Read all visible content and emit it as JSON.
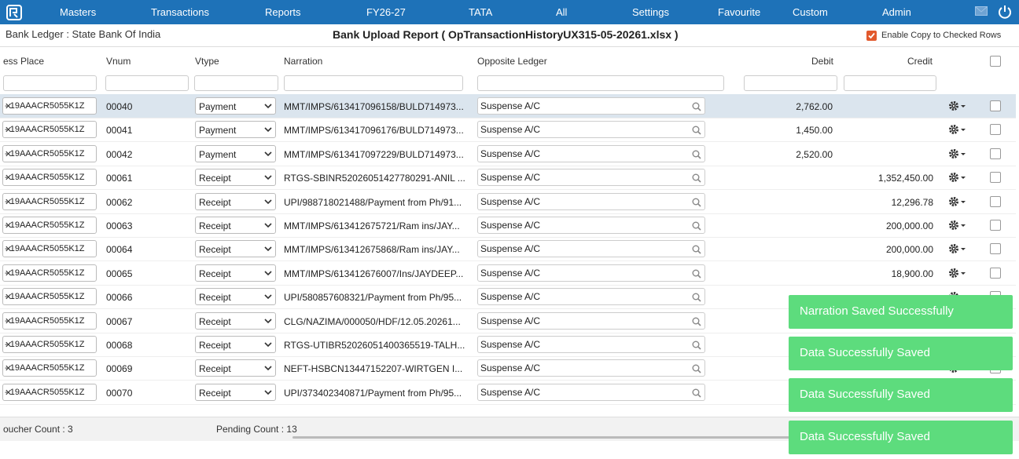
{
  "nav": {
    "items": [
      "Masters",
      "Transactions",
      "Reports",
      "FY26-27",
      "TATA",
      "All",
      "Settings",
      "Favourite",
      "Custom",
      "Admin"
    ]
  },
  "subheader": {
    "ledger_title": "Bank Ledger : State Bank Of India",
    "report_title": "Bank Upload Report ( OpTransactionHistoryUX315-05-20261.xlsx )",
    "copy_label": "Enable Copy to Checked Rows",
    "copy_checked": true
  },
  "columns": [
    "ess Place",
    "Vnum",
    "Vtype",
    "Narration",
    "Opposite Ledger",
    "Debit",
    "Credit"
  ],
  "rows": [
    {
      "place": "- 19AAACR5055K1Z",
      "vnum": "00040",
      "vtype": "Payment",
      "narration": "MMT/IMPS/613417096158/BULD714973...",
      "opposite": "Suspense A/C",
      "debit": "2,762.00",
      "credit": ""
    },
    {
      "place": "- 19AAACR5055K1Z",
      "vnum": "00041",
      "vtype": "Payment",
      "narration": "MMT/IMPS/613417096176/BULD714973...",
      "opposite": "Suspense A/C",
      "debit": "1,450.00",
      "credit": ""
    },
    {
      "place": "- 19AAACR5055K1Z",
      "vnum": "00042",
      "vtype": "Payment",
      "narration": "MMT/IMPS/613417097229/BULD714973...",
      "opposite": "Suspense A/C",
      "debit": "2,520.00",
      "credit": ""
    },
    {
      "place": "- 19AAACR5055K1Z",
      "vnum": "00061",
      "vtype": "Receipt",
      "narration": "RTGS-SBINR52026051427780291-ANIL ...",
      "opposite": "Suspense A/C",
      "debit": "",
      "credit": "1,352,450.00"
    },
    {
      "place": "- 19AAACR5055K1Z",
      "vnum": "00062",
      "vtype": "Receipt",
      "narration": "UPI/988718021488/Payment from Ph/91...",
      "opposite": "Suspense A/C",
      "debit": "",
      "credit": "12,296.78"
    },
    {
      "place": "- 19AAACR5055K1Z",
      "vnum": "00063",
      "vtype": "Receipt",
      "narration": "MMT/IMPS/613412675721/Ram ins/JAY...",
      "opposite": "Suspense A/C",
      "debit": "",
      "credit": "200,000.00"
    },
    {
      "place": "- 19AAACR5055K1Z",
      "vnum": "00064",
      "vtype": "Receipt",
      "narration": "MMT/IMPS/613412675868/Ram ins/JAY...",
      "opposite": "Suspense A/C",
      "debit": "",
      "credit": "200,000.00"
    },
    {
      "place": "- 19AAACR5055K1Z",
      "vnum": "00065",
      "vtype": "Receipt",
      "narration": "MMT/IMPS/613412676007/Ins/JAYDEEP...",
      "opposite": "Suspense A/C",
      "debit": "",
      "credit": "18,900.00"
    },
    {
      "place": "- 19AAACR5055K1Z",
      "vnum": "00066",
      "vtype": "Receipt",
      "narration": "UPI/580857608321/Payment from Ph/95...",
      "opposite": "Suspense A/C",
      "debit": "",
      "credit": ""
    },
    {
      "place": "- 19AAACR5055K1Z",
      "vnum": "00067",
      "vtype": "Receipt",
      "narration": "CLG/NAZIMA/000050/HDF/12.05.20261...",
      "opposite": "Suspense A/C",
      "debit": "",
      "credit": ""
    },
    {
      "place": "- 19AAACR5055K1Z",
      "vnum": "00068",
      "vtype": "Receipt",
      "narration": "RTGS-UTIBR52026051400365519-TALH...",
      "opposite": "Suspense A/C",
      "debit": "",
      "credit": ""
    },
    {
      "place": "- 19AAACR5055K1Z",
      "vnum": "00069",
      "vtype": "Receipt",
      "narration": "NEFT-HSBCN13447152207-WIRTGEN I...",
      "opposite": "Suspense A/C",
      "debit": "",
      "credit": ""
    },
    {
      "place": "- 19AAACR5055K1Z",
      "vnum": "00070",
      "vtype": "Receipt",
      "narration": "UPI/373402340871/Payment from Ph/95...",
      "opposite": "Suspense A/C",
      "debit": "",
      "credit": ""
    }
  ],
  "footer": {
    "voucher_count": "oucher Count : 3",
    "pending_count": "Pending Count : 13"
  },
  "toasts": [
    "Narration Saved Successfully",
    "Data Successfully Saved",
    "Data Successfully Saved",
    "Data Successfully Saved"
  ],
  "colors": {
    "nav_bg": "#1e72b8",
    "toast_bg": "#5ddc7d",
    "checkbox_accent": "#e2592d",
    "selected_row": "#dbe5ee"
  }
}
